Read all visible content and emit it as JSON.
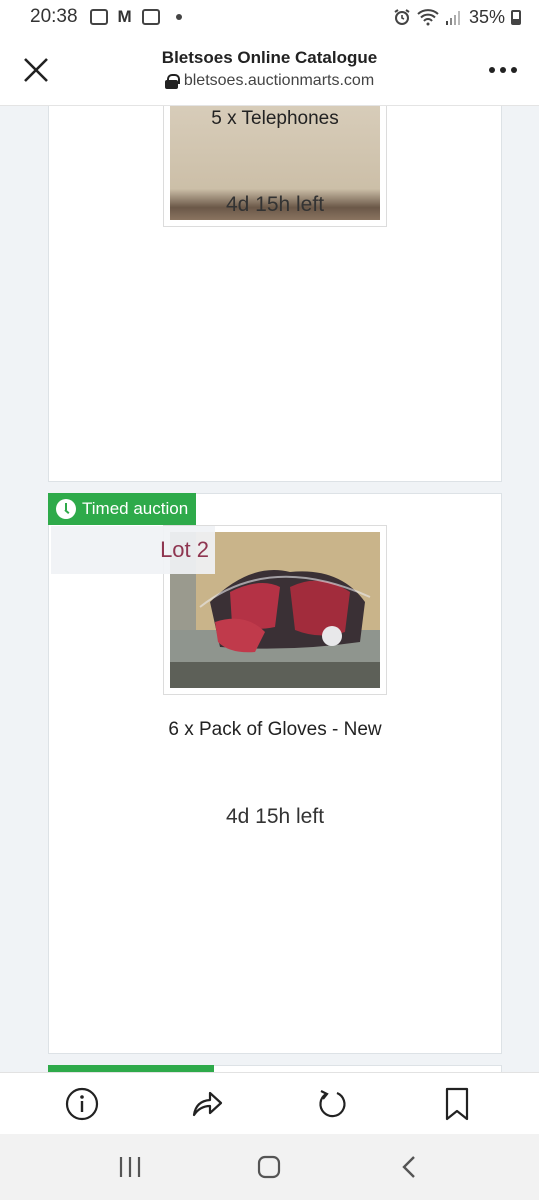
{
  "status_bar": {
    "time": "20:38",
    "battery": "35%"
  },
  "header": {
    "title": "Bletsoes Online Catalogue",
    "url": "bletsoes.auctionmarts.com"
  },
  "lots": [
    {
      "title": "5 x Telephones",
      "time_left": "4d 15h left"
    },
    {
      "badge": "Timed auction",
      "lot_label": "Lot 2",
      "title": "6 x Pack of Gloves - New",
      "time_left": "4d 15h left"
    }
  ],
  "colors": {
    "badge_green": "#2eaa4a",
    "lot_label": "#8e3550"
  },
  "toolbar_icons": [
    "info-icon",
    "share-icon",
    "refresh-icon",
    "bookmark-icon"
  ],
  "nav_icons": [
    "recent-apps-icon",
    "home-icon",
    "back-icon"
  ]
}
